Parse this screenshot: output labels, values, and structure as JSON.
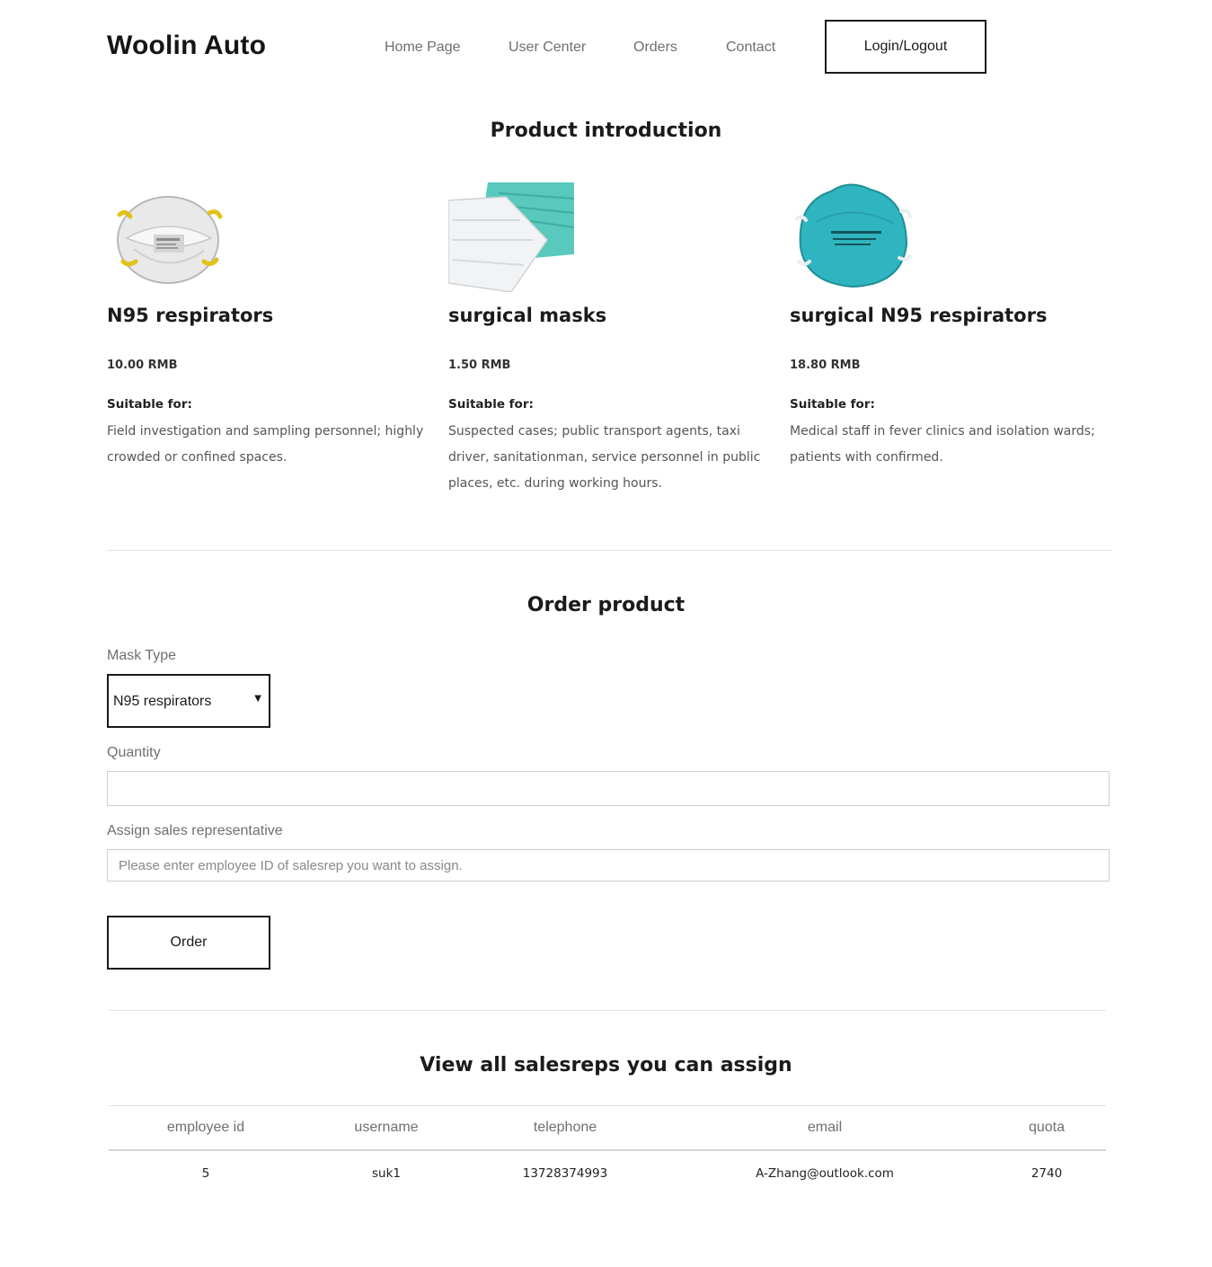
{
  "header": {
    "brand": "Woolin Auto",
    "nav": [
      "Home Page",
      "User Center",
      "Orders",
      "Contact"
    ],
    "login_label": "Login/Logout"
  },
  "products_section": {
    "title": "Product introduction",
    "suitable_label": "Suitable for:",
    "items": [
      {
        "name": "N95 respirators",
        "price": "10.00 RMB",
        "suitable": "Field investigation and sampling personnel; highly crowded or confined spaces.",
        "image_icon": "n95-respirator-image"
      },
      {
        "name": "surgical masks",
        "price": "1.50 RMB",
        "suitable": "Suspected cases; public transport agents, taxi driver, sanitationman, service personnel in public places, etc. during working hours.",
        "image_icon": "surgical-mask-image"
      },
      {
        "name": "surgical N95 respirators",
        "price": "18.80 RMB",
        "suitable": "Medical staff in fever clinics and isolation wards; patients with confirmed.",
        "image_icon": "surgical-n95-respirator-image"
      }
    ]
  },
  "order_form": {
    "title": "Order product",
    "mask_type_label": "Mask Type",
    "mask_type_value": "N95 respirators",
    "quantity_label": "Quantity",
    "quantity_value": "",
    "salesrep_label": "Assign  sales representative",
    "salesrep_placeholder": "Please enter employee ID of salesrep you want to assign.",
    "order_label": "Order"
  },
  "salesreps": {
    "title": "View all salesreps you can assign",
    "columns": [
      "employee id",
      "username",
      "telephone",
      "email",
      "quota"
    ],
    "rows": [
      [
        "5",
        "suk1",
        "13728374993",
        "A-Zhang@outlook.com",
        "2740"
      ]
    ]
  },
  "colors": {
    "text_dark": "#1b1b1b",
    "nav_gray": "#6f6f6f",
    "border_dark": "#1a1a1a",
    "divider": "#e3e3e3",
    "mask_teal": "#2fb5bf"
  }
}
